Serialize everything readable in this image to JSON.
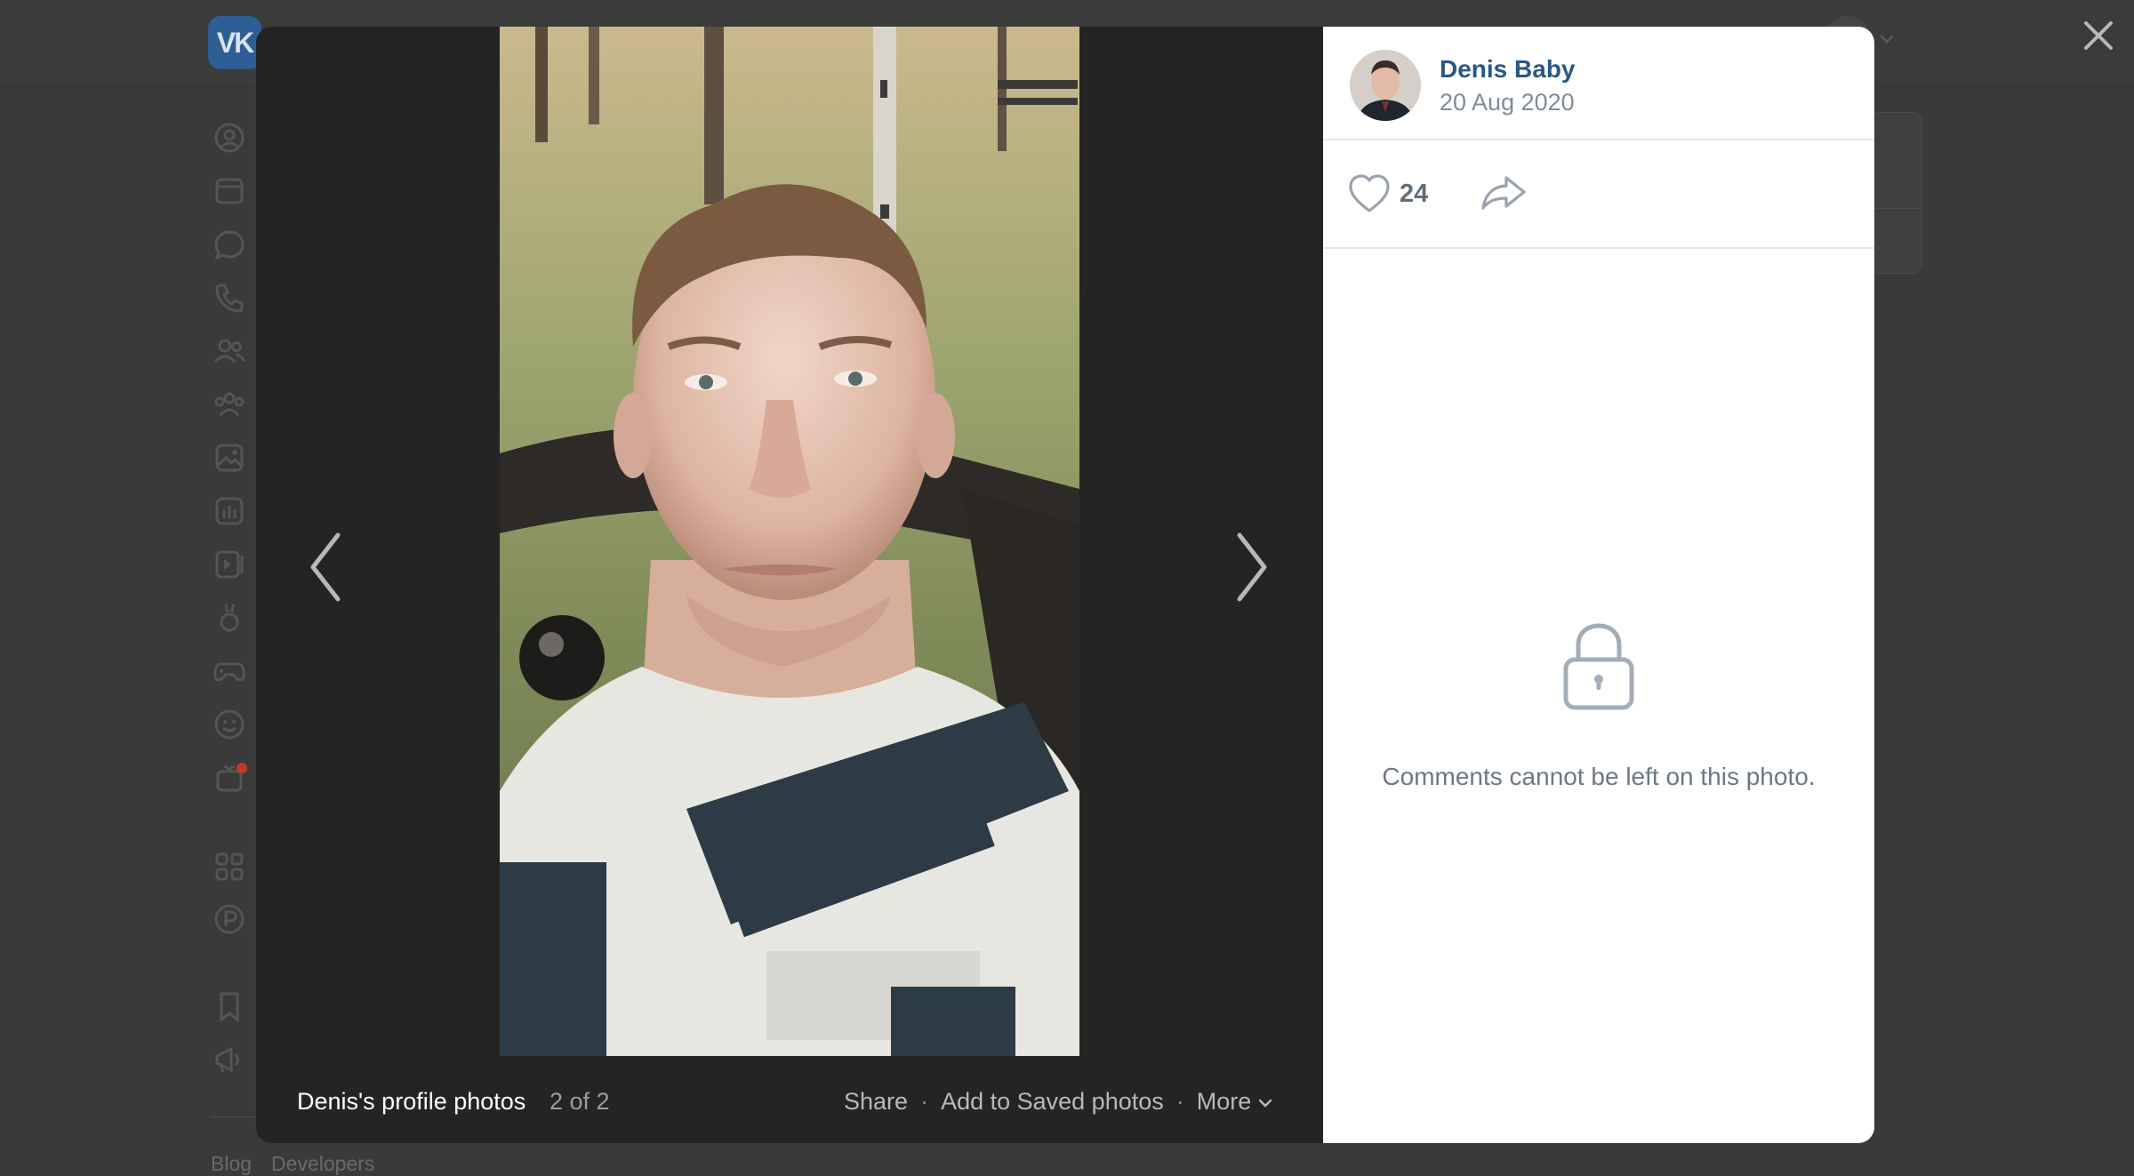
{
  "app": {
    "logo_text": "VK",
    "footer_links": [
      "Blog",
      "Developers"
    ]
  },
  "sidebar": {
    "icons": [
      "profile-icon",
      "news-icon",
      "messenger-icon",
      "calls-icon",
      "friends-icon",
      "communities-icon",
      "photos-icon",
      "music-icon",
      "videos-icon",
      "clips-icon",
      "games-icon",
      "stickers-icon",
      "gifts-icon",
      "mini-apps-icon",
      "payments-icon",
      "bookmarks-icon",
      "ads-icon"
    ]
  },
  "viewer": {
    "album_title": "Denis's profile photos",
    "counter": "2 of 2",
    "actions": {
      "share": "Share",
      "save": "Add to Saved photos",
      "more": "More"
    }
  },
  "panel": {
    "author_name": "Denis Baby",
    "date": "20 Aug 2020",
    "likes": "24",
    "comments_note": "Comments cannot be left on this photo."
  },
  "colors": {
    "link": "#2a5885",
    "muted": "#818c99",
    "overlay": "#242424",
    "brand": "#2d5e95"
  }
}
